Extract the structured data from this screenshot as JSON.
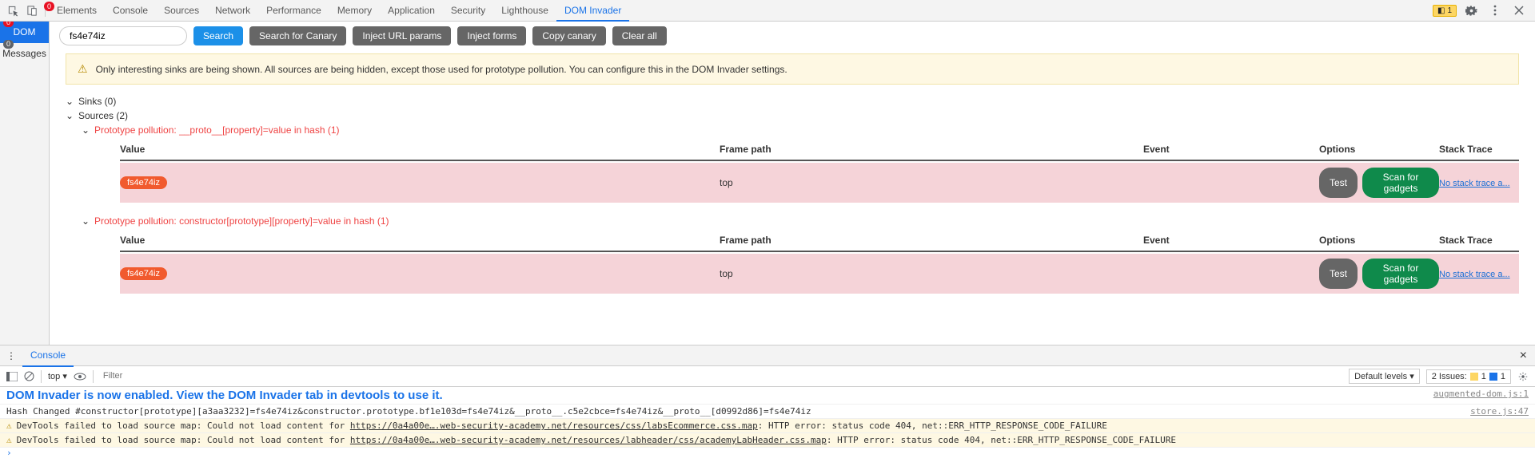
{
  "topTabs": [
    "Elements",
    "Console",
    "Sources",
    "Network",
    "Performance",
    "Memory",
    "Application",
    "Security",
    "Lighthouse",
    "DOM Invader"
  ],
  "topActive": "DOM Invader",
  "elementsErr": "0",
  "topWarn": "1",
  "left": {
    "dom": {
      "label": "DOM",
      "badge": "0"
    },
    "messages": {
      "label": "Messages",
      "badge": "0"
    }
  },
  "search": {
    "value": "fs4e74iz"
  },
  "buttons": {
    "search": "Search",
    "canary": "Search for Canary",
    "inject": "Inject URL params",
    "forms": "Inject forms",
    "copy": "Copy canary",
    "clear": "Clear all"
  },
  "notice": "Only interesting sinks are being shown. All sources are being hidden, except those used for prototype pollution. You can configure this in the DOM Invader settings.",
  "tree": {
    "sinks": "Sinks (0)",
    "sources": "Sources (2)",
    "p1": "Prototype pollution: __proto__[property]=value in hash (1)",
    "p2": "Prototype pollution: constructor[prototype][property]=value in hash (1)"
  },
  "cols": {
    "value": "Value",
    "frame": "Frame path",
    "event": "Event",
    "options": "Options",
    "stack": "Stack Trace"
  },
  "row": {
    "chip": "fs4e74iz",
    "frame": "top",
    "test": "Test",
    "scan": "Scan for gadgets",
    "stack": "No stack trace a..."
  },
  "drawer": {
    "console": "Console"
  },
  "ctools": {
    "top": "top",
    "filterPH": "Filter",
    "levels": "Default levels",
    "issues": "2 Issues:",
    "c1": "1",
    "c2": "1"
  },
  "clines": {
    "head": "DOM Invader is now enabled. View the DOM Invader tab in devtools to use it.",
    "headSrc": "augmented-dom.js:1",
    "hash": "Hash Changed #constructor[prototype][a3aa3232]=fs4e74iz&constructor.prototype.bf1e103d=fs4e74iz&__proto__.c5e2cbce=fs4e74iz&__proto__[d0992d86]=fs4e74iz",
    "hashSrc": "store.js:47",
    "w1a": "DevTools failed to load source map: Could not load content for ",
    "w1u": "https://0a4a00e….web-security-academy.net/resources/css/labsEcommerce.css.map",
    "w1b": ": HTTP error: status code 404, net::ERR_HTTP_RESPONSE_CODE_FAILURE",
    "w2a": "DevTools failed to load source map: Could not load content for ",
    "w2u": "https://0a4a00e….web-security-academy.net/resources/labheader/css/academyLabHeader.css.map",
    "w2b": ": HTTP error: status code 404, net::ERR_HTTP_RESPONSE_CODE_FAILURE"
  }
}
